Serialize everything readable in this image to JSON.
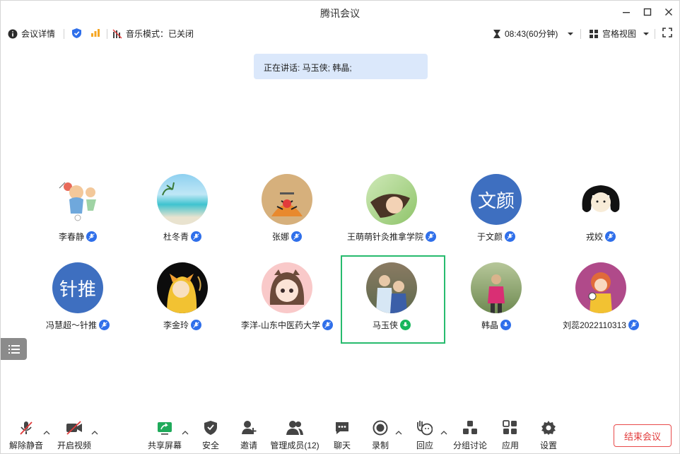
{
  "window": {
    "title": "腾讯会议"
  },
  "infobar": {
    "meeting_details": "会议详情",
    "music_mode": "音乐模式：已关闭",
    "timer": "08:43(60分钟)",
    "view_mode": "宫格视图"
  },
  "speaking": {
    "text": "正在讲话: 马玉侠; 韩晶;"
  },
  "participants": [
    {
      "name": "李春静",
      "mic": "muted"
    },
    {
      "name": "杜冬青",
      "mic": "muted"
    },
    {
      "name": "张娜",
      "mic": "muted"
    },
    {
      "name": "王萌萌针灸推拿学院",
      "mic": "muted"
    },
    {
      "name": "于文颜",
      "mic": "muted",
      "avatar_text": "文颜"
    },
    {
      "name": "戎姣",
      "mic": "muted"
    },
    {
      "name": "冯慧超～针推",
      "mic": "muted",
      "avatar_text": "针推"
    },
    {
      "name": "李金玲",
      "mic": "muted"
    },
    {
      "name": "李洋-山东中医药大学",
      "mic": "muted"
    },
    {
      "name": "马玉侠",
      "mic": "speaking"
    },
    {
      "name": "韩晶",
      "mic": "on"
    },
    {
      "name": "刘蕊2022110313",
      "mic": "muted"
    }
  ],
  "toolbar": {
    "unmute": "解除静音",
    "start_video": "开启视频",
    "share_screen": "共享屏幕",
    "security": "安全",
    "invite": "邀请",
    "manage_members": "管理成员(12)",
    "chat": "聊天",
    "record": "录制",
    "reactions": "回应",
    "breakout": "分组讨论",
    "apps": "应用",
    "settings": "设置",
    "end_meeting": "结束会议"
  },
  "colors": {
    "accent": "#2f6fea",
    "speaking_green": "#17b65c",
    "end_red": "#e23b3b",
    "banner": "#dbe8fb"
  }
}
